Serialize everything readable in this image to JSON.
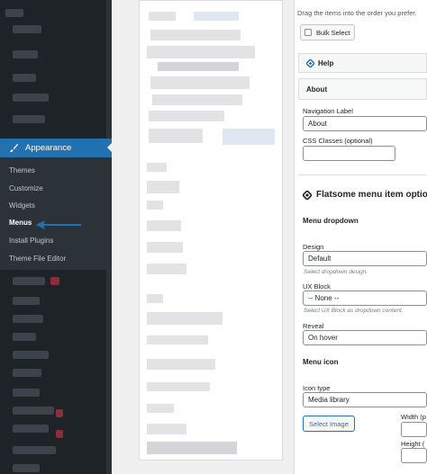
{
  "sidebar": {
    "active_menu": "Appearance",
    "submenu": [
      {
        "label": "Themes",
        "active": false
      },
      {
        "label": "Customize",
        "active": false
      },
      {
        "label": "Widgets",
        "active": false
      },
      {
        "label": "Menus",
        "active": true
      },
      {
        "label": "Install Plugins",
        "active": false
      },
      {
        "label": "Theme File Editor",
        "active": false
      }
    ]
  },
  "panel": {
    "drag_note": "Drag the items into the order you prefer.",
    "bulk_select": "Bulk Select",
    "help": "Help",
    "about": "About",
    "navigation_label": "Navigation Label",
    "navigation_value": "About",
    "css_classes_label": "CSS Classes (optional)",
    "css_classes_value": "",
    "flatsome_title": "Flatsome menu item option",
    "menu_dropdown": "Menu dropdown",
    "design_label": "Design",
    "design_value": "Default",
    "design_hint": "Select dropdown design.",
    "ux_block_label": "UX Block",
    "ux_block_value": "-- None --",
    "ux_block_hint": "Select UX Block as dropdown content.",
    "reveal_label": "Reveal",
    "reveal_value": "On hover",
    "menu_icon": "Menu icon",
    "icon_type_label": "Icon type",
    "icon_type_value": "Media library",
    "select_image": "Select Image",
    "width_label": "Width (p",
    "height_label": "Height (",
    "accent_color": "#2271b1"
  }
}
